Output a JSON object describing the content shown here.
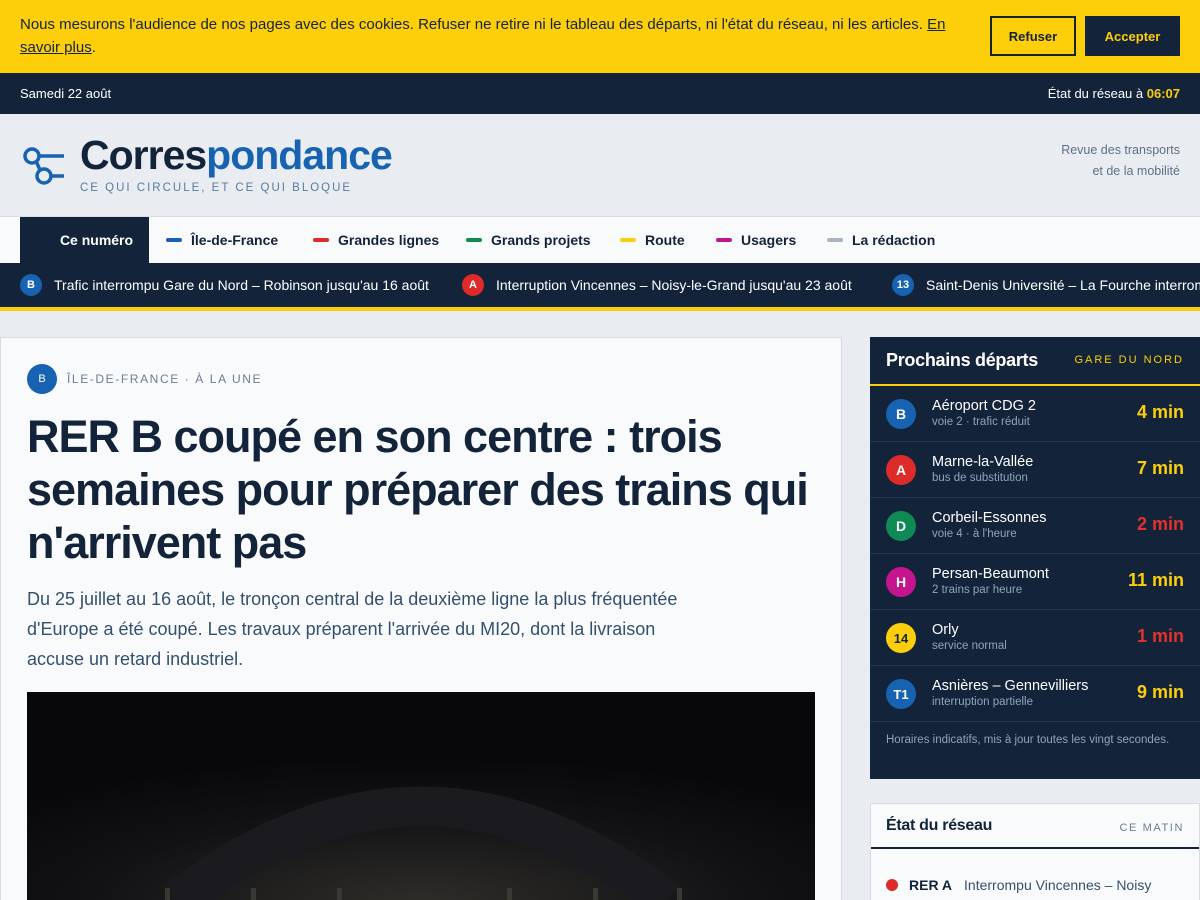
{
  "cookie": {
    "text": "Nous mesurons l'audience de nos pages avec des cookies. Refuser ne retire ni le tableau des départs, ni l'état du réseau, ni les articles.",
    "link": "En savoir plus",
    "refuse": "Refuser",
    "accept": "Accepter"
  },
  "topbar": {
    "date": "Samedi 22 août",
    "status_label": "État du réseau à",
    "status_time": "06:07"
  },
  "masthead": {
    "logo_part1": "Corres",
    "logo_part2": "pondance",
    "tagline": "CE QUI CIRCULE, ET CE QUI BLOQUE",
    "subtitle_line1": "Revue des transports",
    "subtitle_line2": "et de la mobilité"
  },
  "nav": {
    "items": [
      {
        "label": "Ce numéro",
        "color": ""
      },
      {
        "label": "Île-de-France",
        "color": "#1763b2"
      },
      {
        "label": "Grandes lignes",
        "color": "#dc2b28"
      },
      {
        "label": "Grands projets",
        "color": "#0f8a55"
      },
      {
        "label": "Route",
        "color": "#fdcf0a"
      },
      {
        "label": "Usagers",
        "color": "#c4148e"
      },
      {
        "label": "La rédaction",
        "color": "#a6b5c6"
      }
    ]
  },
  "ticker": [
    {
      "badge": "B",
      "color": "#1763b2",
      "text": "Trafic interrompu Gare du Nord – Robinson jusqu'au 16 août"
    },
    {
      "badge": "A",
      "color": "#dc2b28",
      "text": "Interruption Vincennes – Noisy-le-Grand jusqu'au 23 août"
    },
    {
      "badge": "13",
      "color": "#1763b2",
      "text": "Saint-Denis Université – La Fourche interrompu"
    }
  ],
  "article": {
    "badge": "B",
    "kicker": "ÎLE-DE-FRANCE · À LA UNE",
    "headline": "RER B coupé en son centre : trois semaines pour préparer des trains qui n'arrivent pas",
    "lede": "Du 25 juillet au 16 août, le tronçon central de la deuxième ligne la plus fréquentée d'Europe a été coupé. Les travaux préparent l'arrivée du MI20, dont la livraison accuse un retard industriel."
  },
  "departures": {
    "title": "Prochains départs",
    "station": "GARE DU NORD",
    "rows": [
      {
        "badge": "B",
        "badge_color": "#1763b2",
        "badge_text": "#ffffff",
        "destination": "Aéroport CDG 2",
        "note": "voie 2 · trafic réduit",
        "time": "4 min",
        "time_color": "#fdcf0a"
      },
      {
        "badge": "A",
        "badge_color": "#dc2b28",
        "badge_text": "#ffffff",
        "destination": "Marne-la-Vallée",
        "note": "bus de substitution",
        "time": "7 min",
        "time_color": "#fdcf0a"
      },
      {
        "badge": "D",
        "badge_color": "#0f8a55",
        "badge_text": "#ffffff",
        "destination": "Corbeil-Essonnes",
        "note": "voie 4 · à l'heure",
        "time": "2 min",
        "time_color": "#e3312c"
      },
      {
        "badge": "H",
        "badge_color": "#c4148e",
        "badge_text": "#ffffff",
        "destination": "Persan-Beaumont",
        "note": "2 trains par heure",
        "time": "11 min",
        "time_color": "#fdcf0a"
      },
      {
        "badge": "14",
        "badge_color": "#fdcf0a",
        "badge_text": "#13233a",
        "destination": "Orly",
        "note": "service normal",
        "time": "1 min",
        "time_color": "#e3312c"
      },
      {
        "badge": "T1",
        "badge_color": "#1763b2",
        "badge_text": "#ffffff",
        "destination": "Asnières – Gennevilliers",
        "note": "interruption partielle",
        "time": "9 min",
        "time_color": "#fdcf0a"
      }
    ],
    "footnote": "Horaires indicatifs, mis à jour toutes les vingt secondes."
  },
  "network": {
    "title": "État du réseau",
    "meta": "CE MATIN",
    "rows": [
      {
        "line": "RER A",
        "message": "Interrompu Vincennes – Noisy",
        "color": "#dc2b28"
      }
    ]
  }
}
